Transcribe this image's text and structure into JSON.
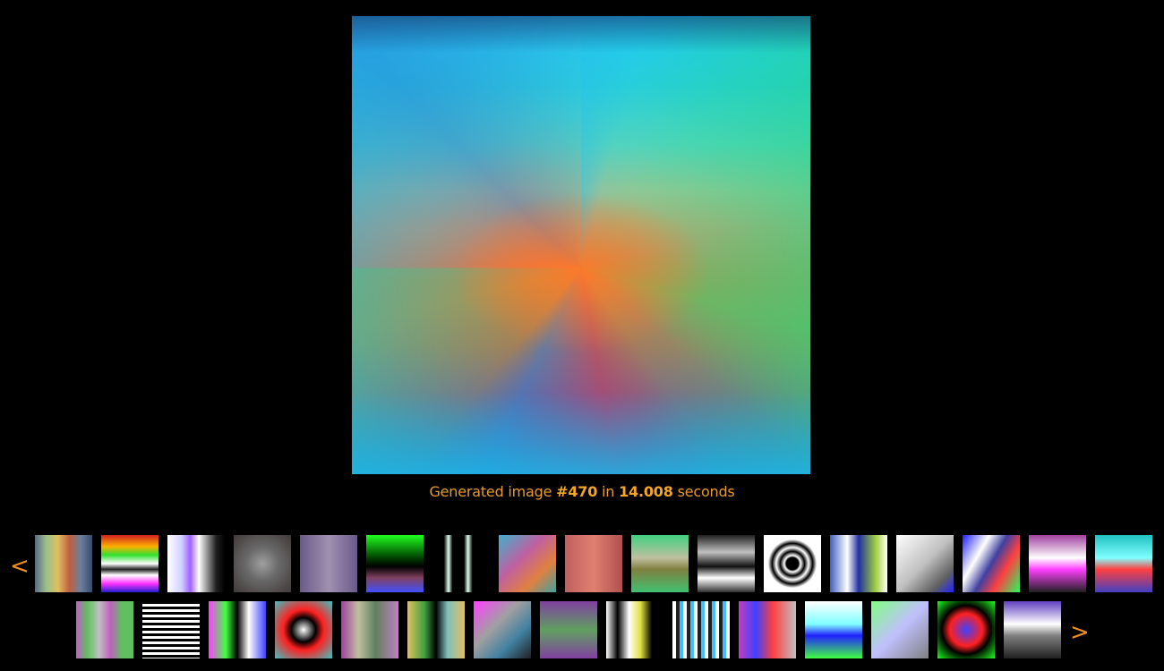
{
  "caption": {
    "prefix": "Generated image",
    "image_number": "#470",
    "in_word": "in",
    "seconds_value": "14.008",
    "suffix": "seconds"
  },
  "nav": {
    "prev_label": "<",
    "next_label": ">"
  },
  "main_image": {
    "name": "generated-image-470"
  },
  "thumbnails": {
    "row1": [
      {
        "bg": "linear-gradient(90deg,#5a6a8a,#9ac08a,#e0c060,#c06040,#6a80a0,#3a4a6a)"
      },
      {
        "bg": "linear-gradient(180deg,#d02020,#ffb000 20%,#30e030 35%,#ffffff 50%,#202020 60%,#ffffff 70%,#ff30ff 85%,#2020d0)"
      },
      {
        "bg": "linear-gradient(90deg,#ffffff,#d0d0ff 25%,#a060ff 40%,#ffffff 55%,#202020 85%,#000)"
      },
      {
        "bg": "radial-gradient(circle,#a0a0a0,#6a6a6a 40%,#403838)"
      },
      {
        "bg": "linear-gradient(90deg,#6a5a8a,#a090b0 50%,#6a5a8a)"
      },
      {
        "bg": "linear-gradient(180deg,#20ff20,#004000 40%,#000 55%,#804060 75%,#4050ff)"
      },
      {
        "bg": "linear-gradient(90deg,#000 20%,#dffff0 28%,#000 35%,#000 55%,#dffff0 62%,#000 70%)"
      },
      {
        "bg": "linear-gradient(135deg,#40b0d0,#c060a0 40%,#e08040 70%,#40a0a0)"
      },
      {
        "bg": "linear-gradient(90deg,#c06060,#e08070 50%,#b05050)"
      },
      {
        "bg": "linear-gradient(180deg,#40d080,#c0c0a0 40%,#808040 60%,#40c070)"
      },
      {
        "bg": "linear-gradient(180deg,#202020,#c0c0c0 30%,#101010 55%,#ffffff 75%,#303030)"
      },
      {
        "bg": "radial-gradient(ellipse,#000 15%,#fff 20%,#000 30%,#fff 40%,#000 50%,#fff 60%)"
      },
      {
        "bg": "linear-gradient(90deg,#4060c0,#ffffff 30%,#2030a0 50%,#a0d040 80%,#ffffff)"
      },
      {
        "bg": "linear-gradient(135deg,#ffffff,#c0c0c0 50%,#606060 80%,#2020ff)"
      },
      {
        "bg": "linear-gradient(120deg,#2020ff,#ffffff 30%,#4040a0 50%,#ff4040 70%,#20ff60)"
      },
      {
        "bg": "linear-gradient(180deg,#a040a0,#ffffff 40%,#ff40ff 60%,#202020)"
      },
      {
        "bg": "linear-gradient(180deg,#20c0c0,#80ffff 40%,#ff4040 60%,#4040c0)"
      }
    ],
    "row2": [
      {
        "bg": "linear-gradient(90deg,#c060c0,#60c060 20%,#c0c0c0 40%,#c060c0 60%,#60c060 80%)"
      },
      {
        "bg": "repeating-linear-gradient(180deg,#000 0 3px,#ffffff 3px 6px)"
      },
      {
        "bg": "linear-gradient(90deg,#ff40ff,#40ff40 30%,#000 50%,#ffffff 70%,#4040ff)"
      },
      {
        "bg": "radial-gradient(circle,#ffffff,#000 30%,#ff2020 50%,#40c0c0)"
      },
      {
        "bg": "linear-gradient(90deg,#a040a0,#c0c0a0 30%,#608060 60%,#c080c0)"
      },
      {
        "bg": "linear-gradient(90deg,#e0c060,#40a040 30%,#000 50%,#80c0c0 70%,#e0c060)"
      },
      {
        "bg": "linear-gradient(135deg,#ff40ff,#a0a0a0 40%,#4080a0 70%,#202020)"
      },
      {
        "bg": "linear-gradient(180deg,#8040a0,#60a060 50%,#8040a0)"
      },
      {
        "bg": "linear-gradient(90deg,#ffffff,#000 20%,#ffffff 40%,#e0e040 60%,#000 80%)"
      },
      {
        "bg": "repeating-linear-gradient(90deg,#ffffff 0 4px,#202020 4px 8px,#40c0ff 8px 12px)"
      },
      {
        "bg": "linear-gradient(90deg,#c040c0,#4040ff 30%,#ff4040 60%,#c0c0c0)"
      },
      {
        "bg": "linear-gradient(180deg,#ffffff,#80ffff 40%,#2020ff 60%,#40ff40)"
      },
      {
        "bg": "linear-gradient(135deg,#80ff80,#c0c0ff 50%,#808080)"
      },
      {
        "bg": "radial-gradient(circle,#4040ff,#ff2020 40%,#000 60%,#20ff20)"
      },
      {
        "bg": "linear-gradient(180deg,#6040c0,#ffffff 40%,#808080 60%,#202020)"
      }
    ]
  }
}
